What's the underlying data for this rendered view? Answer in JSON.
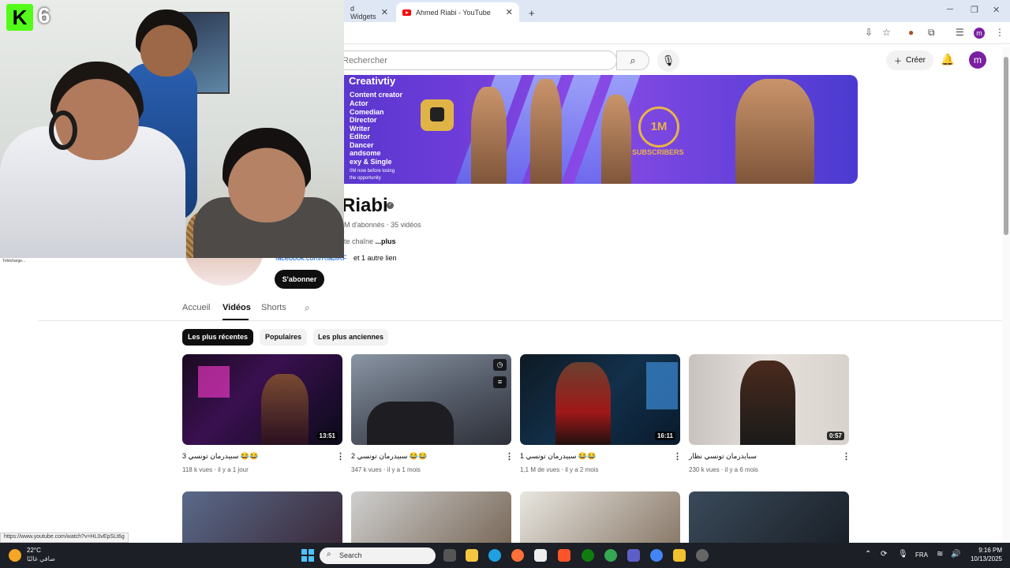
{
  "browser": {
    "tabs": [
      {
        "label": "d Widgets"
      },
      {
        "label": "Ahmed Riabi - YouTube"
      }
    ]
  },
  "youtube": {
    "search_placeholder": "Rechercher",
    "create_label": "Créer",
    "account_initial": "m"
  },
  "banner": {
    "title": "Creativtiy",
    "roles": [
      "Content creator",
      "Actor",
      "Comedian",
      "Director",
      "Writer",
      "Editor",
      "Dancer",
      "andsome",
      "exy & Single"
    ],
    "small_lines": [
      "0M now before losing",
      "the opportunity"
    ],
    "badge": "1M",
    "subscribers": "SUBSCRIBERS"
  },
  "channel": {
    "name": "Riabi",
    "meta": "M d'abonnés ‧ 35 vidéos",
    "desc": "te chaîne ",
    "desc_more": "...plus",
    "link": "facebook.com/RiabiKF",
    "link_more": "et 1 autre lien",
    "subscribe": "S'abonner"
  },
  "tabs": [
    "Accueil",
    "Vidéos",
    "Shorts"
  ],
  "chips": [
    "Les plus récentes",
    "Populaires",
    "Les plus anciennes"
  ],
  "videos": [
    {
      "title": "3 سبيدرمان تونسي 😂😂",
      "meta": "118 k vues ‧ il y a 1 jour",
      "duration": "13:51"
    },
    {
      "title": "2 سبيدرمان تونسي 😂😂",
      "meta": "347 k vues ‧ il y a 1 mois",
      "duration": ""
    },
    {
      "title": "1 سبيدرمان تونسي 😂😂",
      "meta": "1,1 M de vues ‧ il y a 2 mois",
      "duration": "16:11"
    },
    {
      "title": "سبايدرمان تونسي نظار",
      "meta": "230 k vues ‧ il y a 6 mois",
      "duration": "0:57"
    }
  ],
  "stream": {
    "logo": "K",
    "number": "6",
    "download_label": "Télécharge..."
  },
  "status_url": "https://www.youtube.com/watch?v=HL0vEpSLt6g",
  "taskbar": {
    "search": "Search",
    "temp": "22°C",
    "weather": "صافي غالبًا",
    "lang": "FRA",
    "time": "9:16 PM",
    "date": "10/13/2025"
  }
}
